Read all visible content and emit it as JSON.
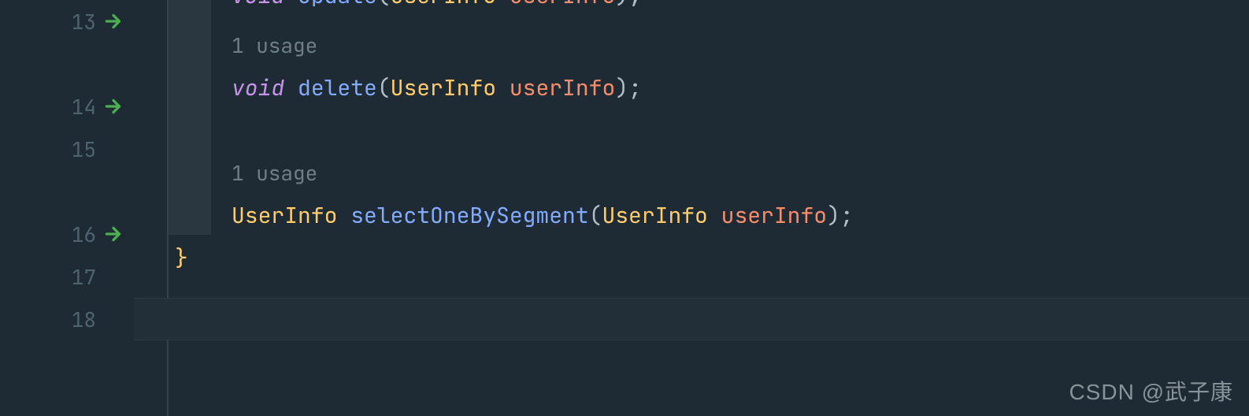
{
  "gutter": {
    "line13": "13",
    "line14": "14",
    "line15": "15",
    "line16": "16",
    "line17": "17",
    "line18": "18"
  },
  "hints": {
    "usage1": "1 usage",
    "usage2": "1 usage"
  },
  "code": {
    "line13": {
      "kw": "void",
      "method": "Update",
      "lparen": "(",
      "type": "UserInfo",
      "param": "userInfo",
      "rparen": ")",
      "semi": ";"
    },
    "line14": {
      "kw": "void",
      "method": "delete",
      "lparen": "(",
      "type": "UserInfo",
      "param": "userInfo",
      "rparen": ")",
      "semi": ";"
    },
    "line16": {
      "rettype": "UserInfo",
      "method": "selectOneBySegment",
      "lparen": "(",
      "type": "UserInfo",
      "param": "userInfo",
      "rparen": ")",
      "semi": ";"
    },
    "line17": {
      "brace": "}"
    }
  },
  "watermark": "CSDN @武子康"
}
